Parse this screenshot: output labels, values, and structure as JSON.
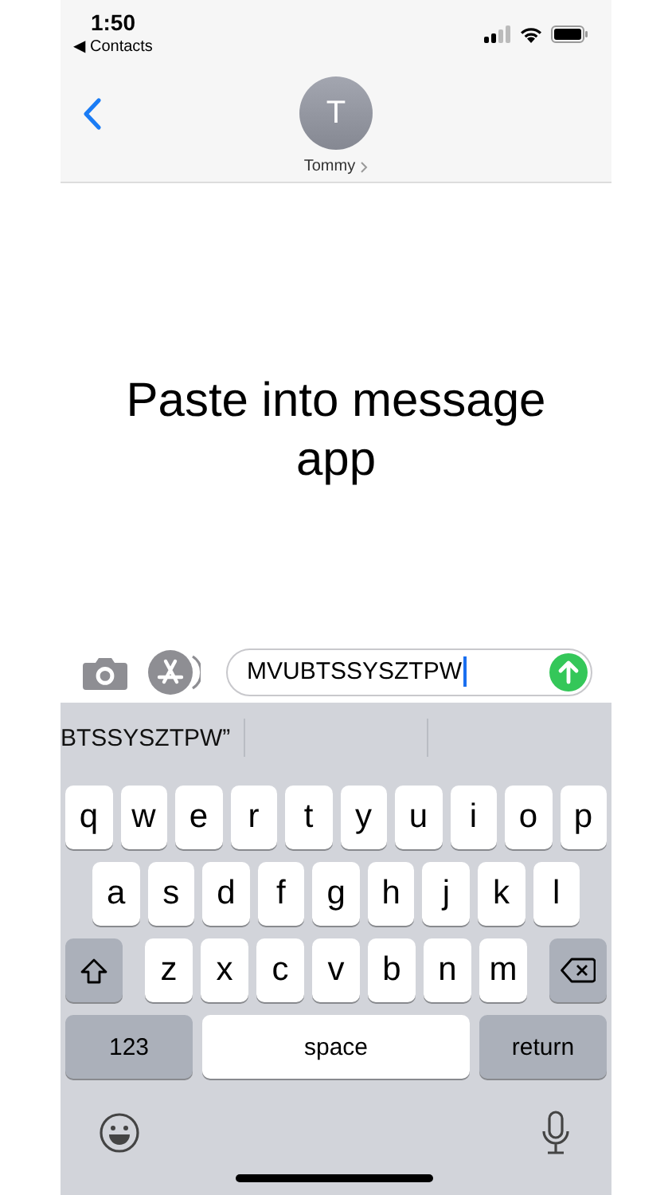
{
  "status_bar": {
    "time": "1:50",
    "back_app": "◀ Contacts"
  },
  "header": {
    "initial": "T",
    "name": "Tommy"
  },
  "message": {
    "text": "Paste into message app"
  },
  "compose": {
    "value": "MVUBTSSYSZTPW"
  },
  "suggestions": [
    "BTSSYSZTPW”"
  ],
  "keyboard": {
    "rows": [
      [
        {
          "kind": "letter",
          "label": "q"
        },
        {
          "kind": "letter",
          "label": "w"
        },
        {
          "kind": "letter",
          "label": "e"
        },
        {
          "kind": "letter",
          "label": "r"
        },
        {
          "kind": "letter",
          "label": "t"
        },
        {
          "kind": "letter",
          "label": "y"
        },
        {
          "kind": "letter",
          "label": "u"
        },
        {
          "kind": "letter",
          "label": "i"
        },
        {
          "kind": "letter",
          "label": "o"
        },
        {
          "kind": "letter",
          "label": "p"
        }
      ],
      [
        {
          "kind": "letter",
          "label": "a"
        },
        {
          "kind": "letter",
          "label": "s"
        },
        {
          "kind": "letter",
          "label": "d"
        },
        {
          "kind": "letter",
          "label": "f"
        },
        {
          "kind": "letter",
          "label": "g"
        },
        {
          "kind": "letter",
          "label": "h"
        },
        {
          "kind": "letter",
          "label": "j"
        },
        {
          "kind": "letter",
          "label": "k"
        },
        {
          "kind": "letter",
          "label": "l"
        }
      ],
      [
        {
          "kind": "shift"
        },
        {
          "kind": "letter",
          "label": "z"
        },
        {
          "kind": "letter",
          "label": "x"
        },
        {
          "kind": "letter",
          "label": "c"
        },
        {
          "kind": "letter",
          "label": "v"
        },
        {
          "kind": "letter",
          "label": "b"
        },
        {
          "kind": "letter",
          "label": "n"
        },
        {
          "kind": "letter",
          "label": "m"
        },
        {
          "kind": "delete"
        }
      ]
    ],
    "bottom_row": [
      {
        "kind": "mode",
        "label": "123"
      },
      {
        "kind": "space",
        "label": "space"
      },
      {
        "kind": "return",
        "label": "return"
      }
    ]
  }
}
